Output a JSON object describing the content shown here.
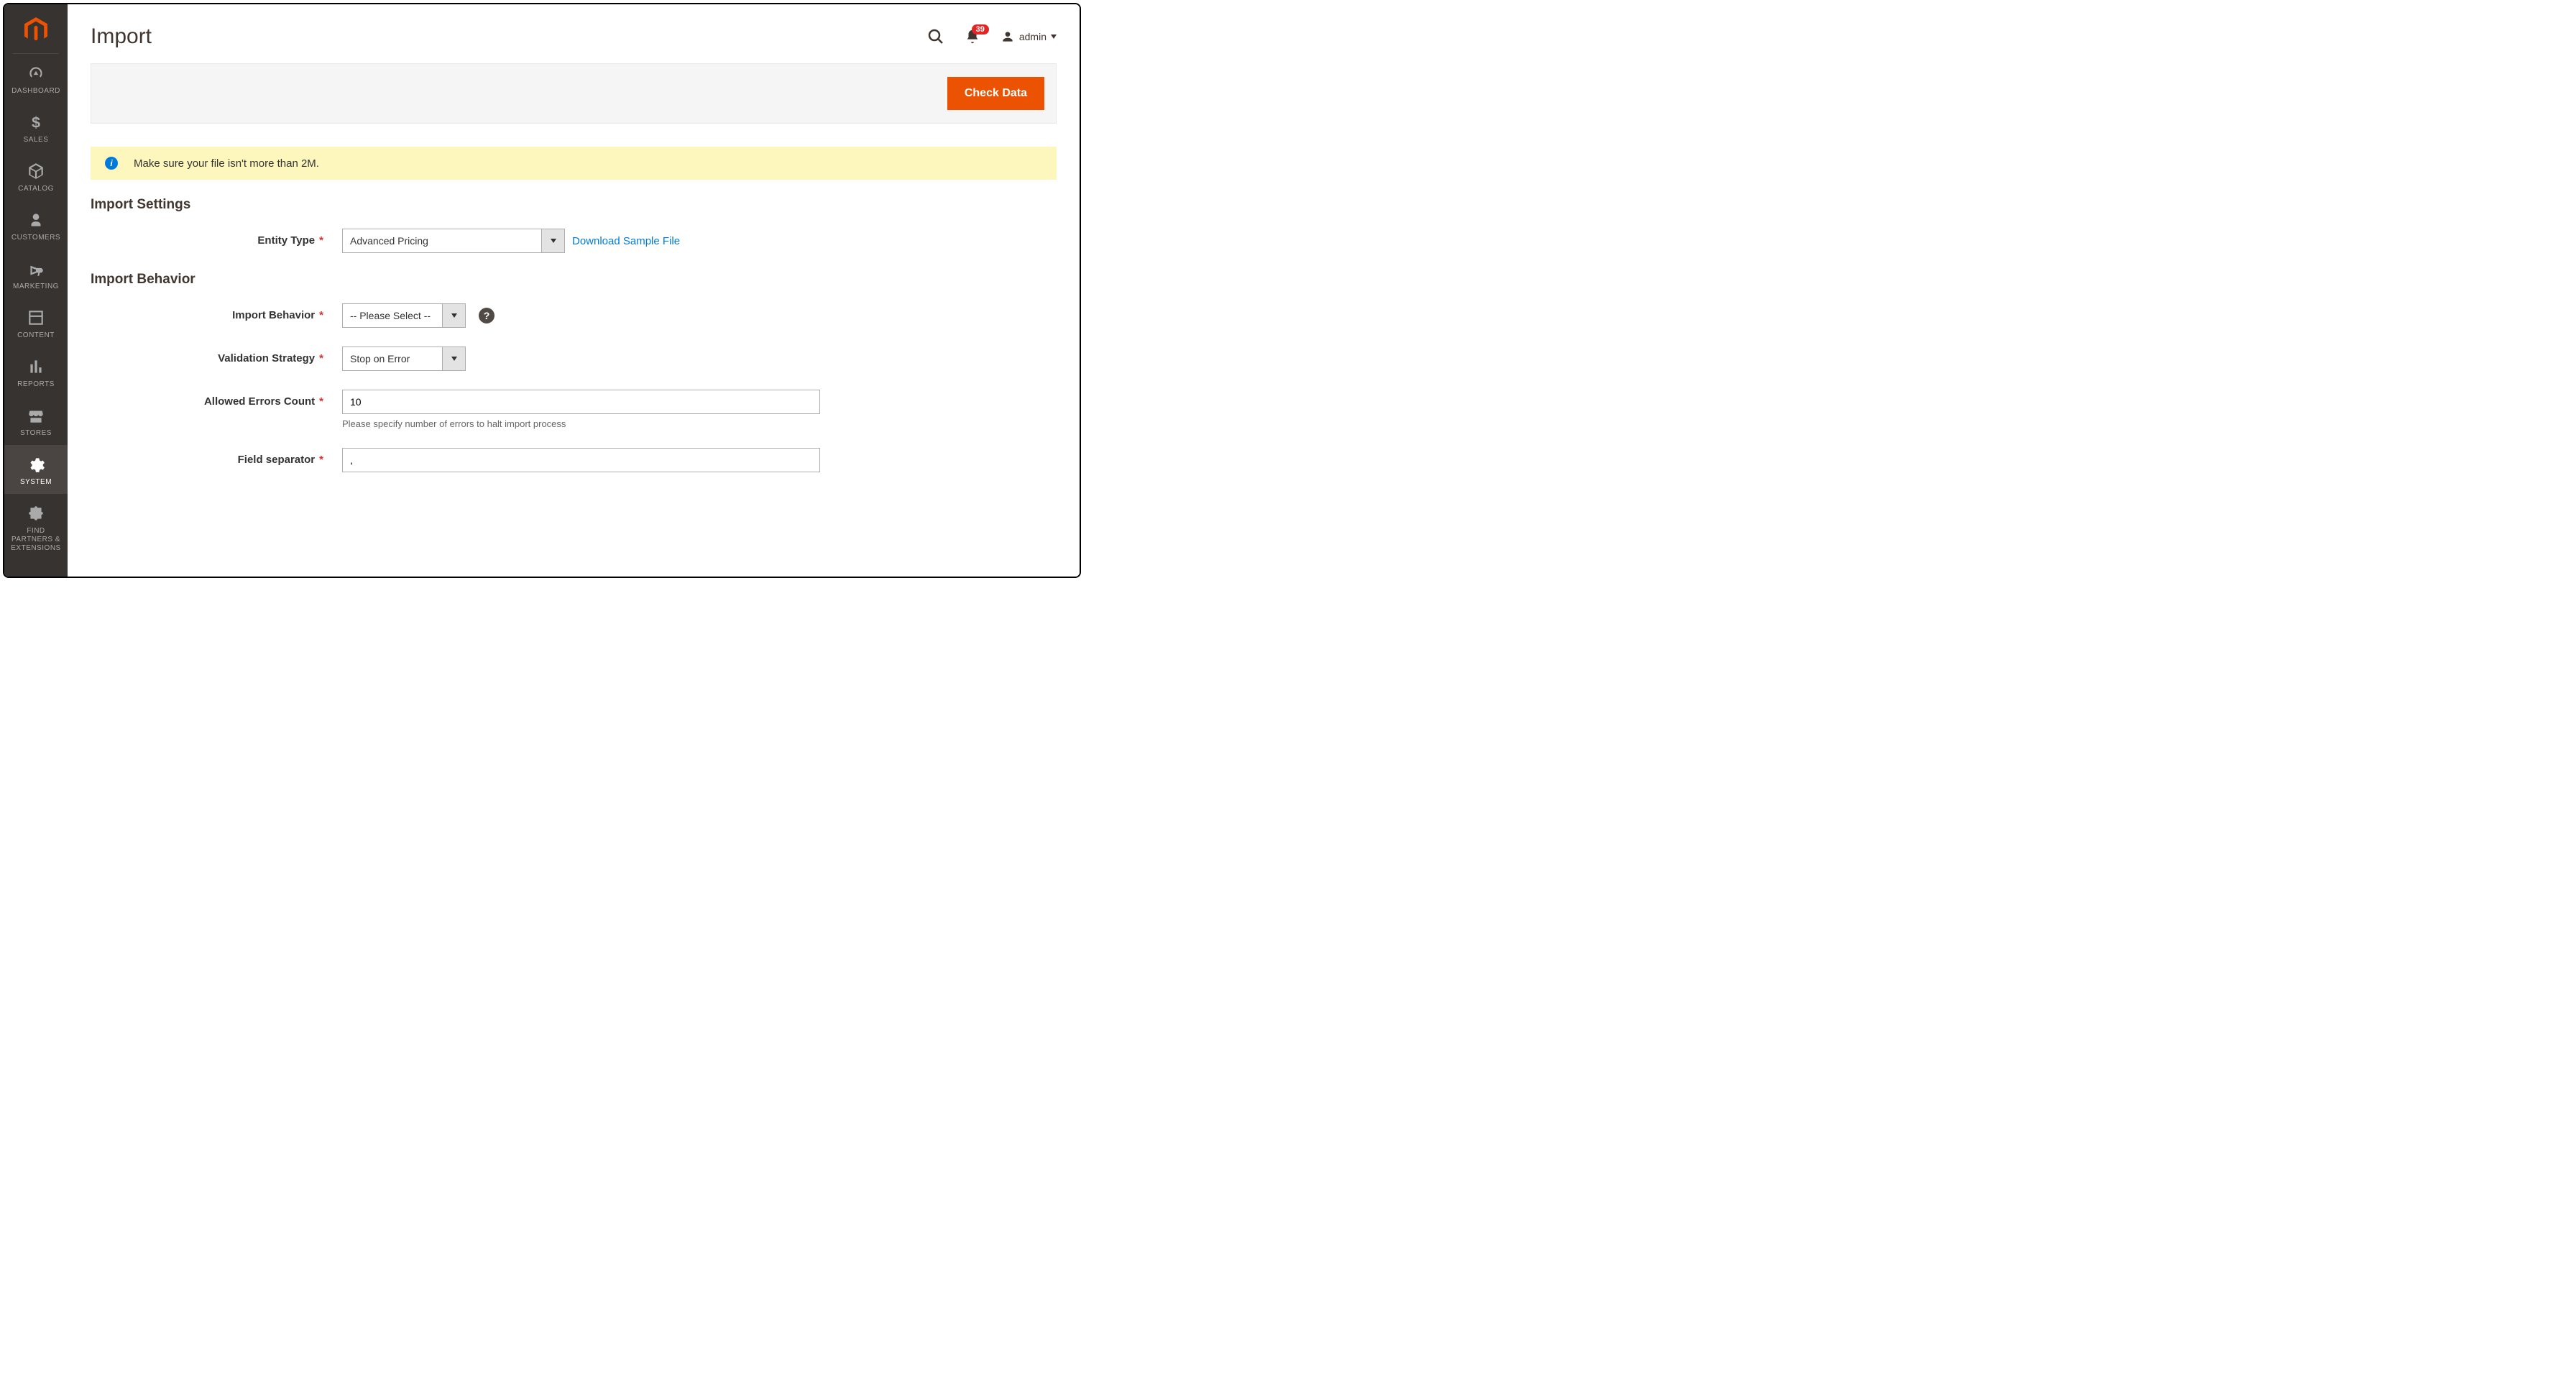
{
  "sidebar": {
    "items": [
      {
        "label": "DASHBOARD"
      },
      {
        "label": "SALES"
      },
      {
        "label": "CATALOG"
      },
      {
        "label": "CUSTOMERS"
      },
      {
        "label": "MARKETING"
      },
      {
        "label": "CONTENT"
      },
      {
        "label": "REPORTS"
      },
      {
        "label": "STORES"
      },
      {
        "label": "SYSTEM"
      },
      {
        "label": "FIND PARTNERS & EXTENSIONS"
      }
    ]
  },
  "header": {
    "title": "Import",
    "notification_count": "39",
    "user_name": "admin"
  },
  "action_bar": {
    "check_data": "Check Data"
  },
  "message": {
    "info": "Make sure your file isn't more than 2M."
  },
  "sections": {
    "import_settings": {
      "title": "Import Settings",
      "entity_type_label": "Entity Type",
      "entity_type_value": "Advanced Pricing",
      "download_link": "Download Sample File"
    },
    "import_behavior": {
      "title": "Import Behavior",
      "behavior_label": "Import Behavior",
      "behavior_value": "-- Please Select --",
      "validation_label": "Validation Strategy",
      "validation_value": "Stop on Error",
      "errors_count_label": "Allowed Errors Count",
      "errors_count_value": "10",
      "errors_count_note": "Please specify number of errors to halt import process",
      "field_separator_label": "Field separator",
      "field_separator_value": ","
    }
  }
}
